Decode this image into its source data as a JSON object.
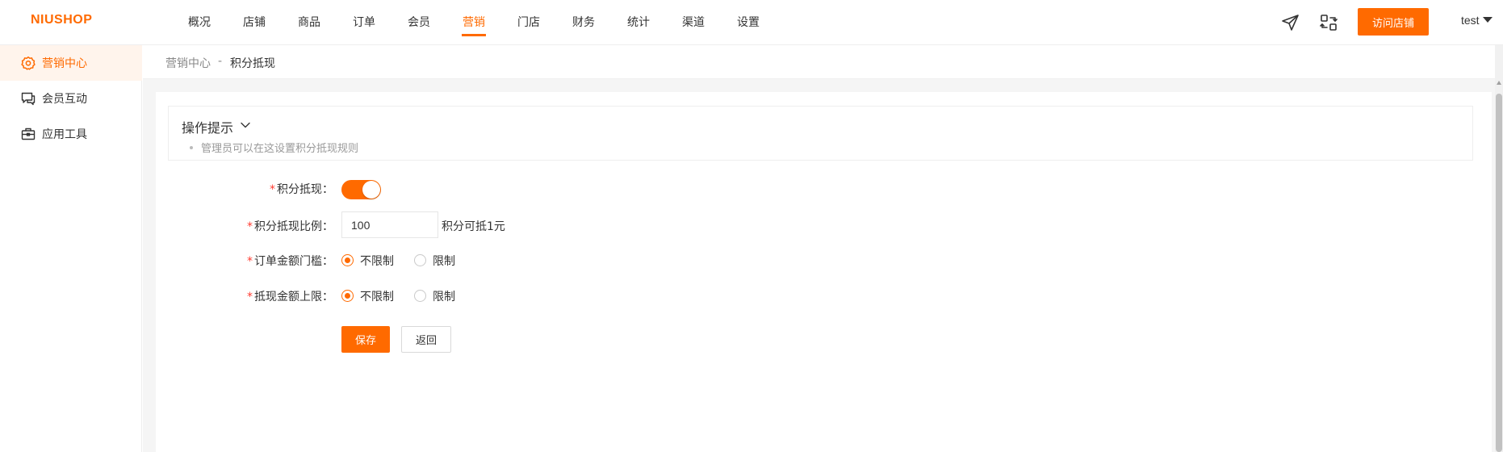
{
  "brand": {
    "logo": "NIUSHOP",
    "accent_color": "#ff6a00"
  },
  "topnav": {
    "items": [
      {
        "label": "概况",
        "active": false
      },
      {
        "label": "店铺",
        "active": false
      },
      {
        "label": "商品",
        "active": false
      },
      {
        "label": "订单",
        "active": false
      },
      {
        "label": "会员",
        "active": false
      },
      {
        "label": "营销",
        "active": true
      },
      {
        "label": "门店",
        "active": false
      },
      {
        "label": "财务",
        "active": false
      },
      {
        "label": "统计",
        "active": false
      },
      {
        "label": "渠道",
        "active": false
      },
      {
        "label": "设置",
        "active": false
      }
    ],
    "icons": [
      "paper-plane-icon",
      "switch-arrows-icon"
    ],
    "visit_store_label": "访问店铺",
    "username": "test"
  },
  "sidebar": {
    "items": [
      {
        "label": "营销中心",
        "icon": "gear-icon",
        "active": true
      },
      {
        "label": "会员互动",
        "icon": "chat-bubbles-icon",
        "active": false
      },
      {
        "label": "应用工具",
        "icon": "toolbox-icon",
        "active": false
      }
    ]
  },
  "breadcrumb": {
    "parent": "营销中心",
    "separator": "-",
    "current": "积分抵现"
  },
  "tips": {
    "title": "操作提示",
    "lines": [
      "管理员可以在这设置积分抵现规则"
    ]
  },
  "form": {
    "enable": {
      "label": "积分抵现：",
      "value": true
    },
    "ratio": {
      "label": "积分抵现比例：",
      "value": "100",
      "suffix": "积分可抵1元"
    },
    "order_threshold": {
      "label": "订单金额门槛：",
      "options": [
        {
          "label": "不限制",
          "checked": true
        },
        {
          "label": "限制",
          "checked": false
        }
      ]
    },
    "deduct_limit": {
      "label": "抵现金额上限：",
      "options": [
        {
          "label": "不限制",
          "checked": true
        },
        {
          "label": "限制",
          "checked": false
        }
      ]
    },
    "save_label": "保存",
    "back_label": "返回"
  }
}
